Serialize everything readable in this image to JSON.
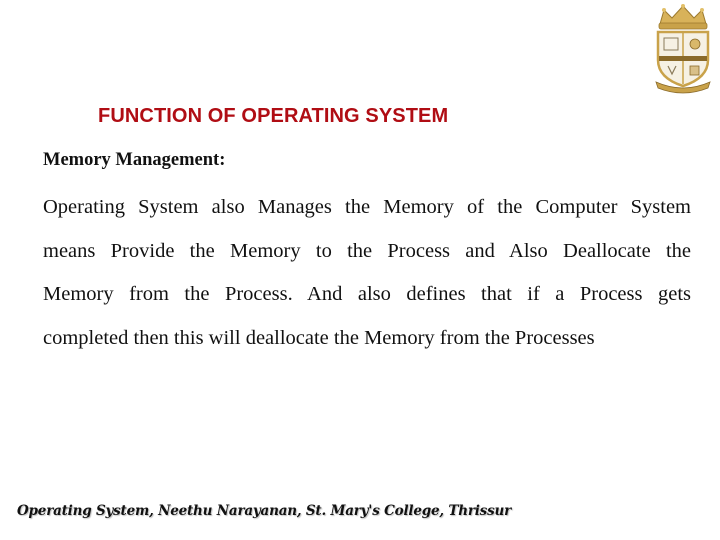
{
  "slide": {
    "logo": {
      "icon": "college-crest-icon",
      "colors": {
        "gold": "#c9a24a",
        "shield": "#f6f1e4",
        "band": "#8a6a2a"
      }
    },
    "title": "FUNCTION OF OPERATING SYSTEM",
    "title_color": "#b00d14",
    "subheading": "Memory Management:",
    "paragraph_lines": [
      "Operating System also Manages the Memory of the Computer System",
      "means Provide the Memory to the Process and Also Deallocate the",
      "Memory from the Process. And also defines that if a Process gets",
      "completed then this will deallocate the Memory from the Processes"
    ],
    "footer": "Operating System, Neethu Narayanan, St. Mary's College, Thrissur"
  }
}
